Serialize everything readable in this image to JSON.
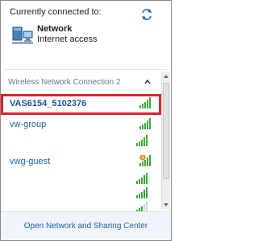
{
  "header": {
    "title": "Currently connected to:"
  },
  "connected": {
    "name": "Network",
    "status": "Internet access"
  },
  "section": {
    "title": "Wireless Network Connection 2"
  },
  "networks": [
    {
      "name": "VAS6154_5102376",
      "selected": true,
      "secured": false
    },
    {
      "name": "vw-group",
      "selected": false,
      "secured": false
    },
    {
      "name": "",
      "selected": false,
      "secured": false
    },
    {
      "name": "vwg-guest",
      "selected": false,
      "secured": true
    },
    {
      "name": "",
      "selected": false,
      "secured": false
    },
    {
      "name": "",
      "selected": false,
      "secured": false
    },
    {
      "name": "",
      "selected": false,
      "secured": false
    }
  ],
  "footer": {
    "link": "Open Network and Sharing Center"
  },
  "colors": {
    "highlight": "#d9242b",
    "link": "#1a5fa8",
    "signal": "#3fa83a"
  }
}
